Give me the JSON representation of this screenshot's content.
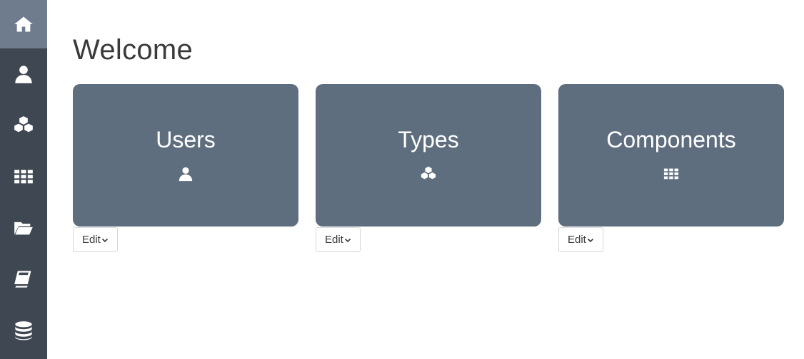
{
  "sidebar": {
    "items": [
      {
        "icon": "home-icon",
        "active": true
      },
      {
        "icon": "user-icon",
        "active": false
      },
      {
        "icon": "cubes-icon",
        "active": false
      },
      {
        "icon": "grid-icon",
        "active": false
      },
      {
        "icon": "folder-open-icon",
        "active": false
      },
      {
        "icon": "book-icon",
        "active": false
      },
      {
        "icon": "database-icon",
        "active": false
      }
    ]
  },
  "main": {
    "title": "Welcome",
    "cards": [
      {
        "title": "Users",
        "icon": "user-icon",
        "edit_label": "Edit"
      },
      {
        "title": "Types",
        "icon": "cubes-icon",
        "edit_label": "Edit"
      },
      {
        "title": "Components",
        "icon": "grid-icon",
        "edit_label": "Edit"
      }
    ]
  },
  "colors": {
    "sidebar_bg": "#3f4852",
    "sidebar_active": "#6e7c8d",
    "card_bg": "#5f6e7e",
    "text": "#3a3a3a"
  }
}
